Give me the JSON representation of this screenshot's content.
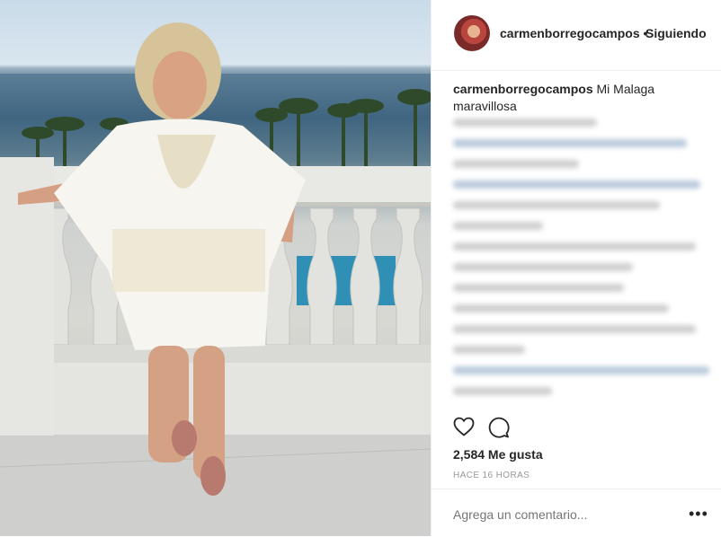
{
  "post": {
    "username": "carmenborregocampos",
    "separator": "•",
    "follow_label": "Siguiendo",
    "caption_user": "carmenborregocampos",
    "caption_text": "Mi Malaga maravillosa",
    "likes": "2,584 Me gusta",
    "time": "HACE 16 HORAS",
    "comment_placeholder": "Agrega un comentario...",
    "more_label": "•••"
  },
  "icons": {
    "like": "heart-icon",
    "comment": "comment-icon",
    "more": "more-options-icon",
    "avatar": "profile-avatar"
  },
  "colors": {
    "text": "#262626",
    "muted": "#999999",
    "border": "#efefef",
    "sea": "#3f6580"
  }
}
